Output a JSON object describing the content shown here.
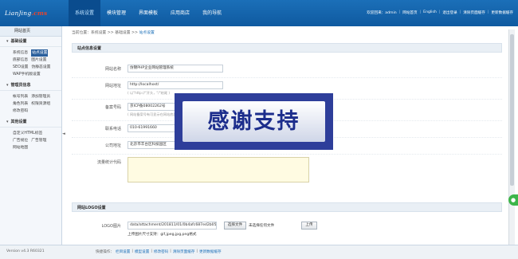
{
  "header": {
    "logo": {
      "text": "LianJing",
      "suffix": ".cms"
    },
    "nav": [
      "系统设置",
      "模块管理",
      "界面模板",
      "应用商店",
      "我的导航"
    ],
    "active_nav": 0,
    "links": [
      "欢迎回来：admin",
      "网站首页",
      "English",
      "退出登录",
      "清除页面缓存",
      "更新数据缓存"
    ]
  },
  "sidebar": {
    "home": "网站首页",
    "sections": [
      {
        "title": "基础设置",
        "rows": [
          [
            "系统信息",
            "站点设置"
          ],
          [
            "底部信息",
            "图片设置"
          ],
          [
            "SEO设置",
            "伪静态设置"
          ],
          [
            "WAP手机版设置"
          ]
        ]
      },
      {
        "title": "管理员信息",
        "rows": [
          [
            "帐号列表",
            "添加管理员"
          ],
          [
            "角色列表",
            "权限资源组"
          ],
          [
            "修改密码"
          ]
        ]
      },
      {
        "title": "其他设置",
        "rows": [
          [
            "自定义HTML标签"
          ],
          [
            "广告规位",
            "广告管理"
          ],
          [
            "网站地图"
          ]
        ]
      }
    ],
    "highlight": "站点设置",
    "toggle": "◄"
  },
  "breadcrumb": {
    "prefix": "当前位置：系统设置",
    "sep": ">>",
    "mid": "基础设置",
    "current": "站点设置"
  },
  "form": {
    "title": "站点信息设置",
    "site_name": {
      "label": "网站名称",
      "value": "仿锦PHP企业网站管理系统"
    },
    "site_url": {
      "label": "网站地址",
      "value": "http://localhost/",
      "hint": "( 以\"http://\"开头，\"/\"结尾 )"
    },
    "icp": {
      "label": "备案号码",
      "value": "京ICP备08002262号",
      "hint": "( 网站备案号有可显示在网站底部 )"
    },
    "phone": {
      "label": "联系电话",
      "value": "010-61991660"
    },
    "address": {
      "label": "公司地址",
      "value": "北京市丰台区科技园区"
    },
    "stats": {
      "label": "流量统计代码",
      "value": ""
    }
  },
  "logo_section": {
    "title": "网站LOGO设置",
    "label": "LOGO图片",
    "value": "data/attachment/201811/01/0b4afc687ed2b05",
    "choose_button": "选择文件",
    "no_file": "未选择任何文件",
    "upload_button": "上传",
    "hint": "上传图片尺寸支持：gif,jpeg,jpg,png格式"
  },
  "overlay": {
    "text": "感谢支持"
  },
  "footer": {
    "version": "Version v4.3 R60321",
    "quick_label": "快捷操作：",
    "quick": [
      "栏目设置",
      "模型设置",
      "修改密码",
      "清除页面缓存",
      "更新数据缓存"
    ]
  },
  "colors": {
    "header": "#1464ac",
    "accent": "#1b6fb8",
    "overlay": "#2e3e9a",
    "overlay_text": "#1c2d8c",
    "textarea": "#fffbe2"
  }
}
